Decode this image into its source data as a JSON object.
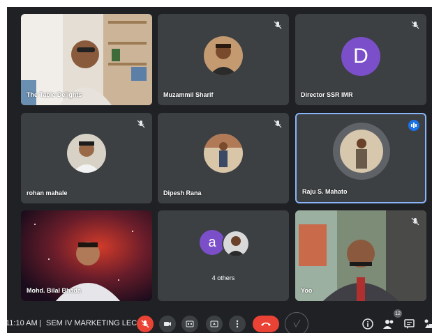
{
  "participants": [
    {
      "name": "The Table Delights",
      "muted": false
    },
    {
      "name": "Muzammil Sharif",
      "muted": true
    },
    {
      "name": "Director SSR IMR",
      "muted": true,
      "avatar_letter": "D"
    },
    {
      "name": "rohan mahale",
      "muted": true
    },
    {
      "name": "Dipesh Rana",
      "muted": true
    },
    {
      "name": "Raju S. Mahato",
      "muted": false,
      "speaking": true
    },
    {
      "name": "Mohd. Bilal Bhada",
      "muted": false
    },
    {
      "name": "4 others",
      "avatar_letter": "a"
    },
    {
      "name": "Yoo",
      "muted": true
    }
  ],
  "bottom_bar": {
    "time": "11:10 AM",
    "separator": "|",
    "meeting_title": "SEM IV MARKETING LEC...",
    "people_count": "12"
  },
  "colors": {
    "background": "#202124",
    "tile": "#3c4043",
    "red": "#ea4335",
    "active_border": "#8ab4f8",
    "speaking_badge": "#1a73e8",
    "avatar_purple": "#7b4fc9"
  },
  "icons": [
    "mic-off-icon",
    "videocam-icon",
    "captions-icon",
    "present-icon",
    "more-icon",
    "call-end-icon",
    "info-icon",
    "people-icon",
    "chat-icon",
    "activities-icon"
  ]
}
